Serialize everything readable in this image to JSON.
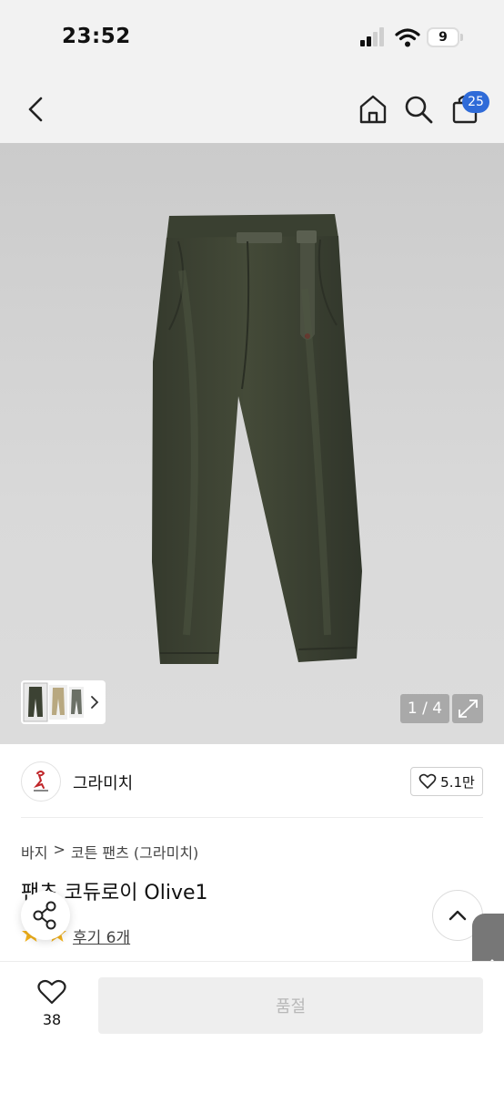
{
  "status_bar": {
    "time": "23:52",
    "battery": "9"
  },
  "header": {
    "cart_count": "25"
  },
  "gallery": {
    "counter": "1 / 4"
  },
  "brand": {
    "name": "그라미치",
    "likes": "5.1만"
  },
  "breadcrumb": {
    "level1": "바지",
    "separator": ">",
    "level2": "코튼 팬츠 (그라미치)"
  },
  "product": {
    "title": "팬츠 코듀로이 Olive1",
    "reviews": "후기 6개"
  },
  "bottom_bar": {
    "wish_count": "38",
    "buy_label": "품절"
  },
  "colors": {
    "accent": "#2f6bd8",
    "pants": "#3c4233",
    "rating_star": "#f3b21a"
  },
  "icons": [
    "back-arrow-icon",
    "home-icon",
    "search-icon",
    "cart-icon",
    "expand-icon",
    "heart-icon",
    "share-icon",
    "chevron-up-icon",
    "chevron-right-icon"
  ]
}
